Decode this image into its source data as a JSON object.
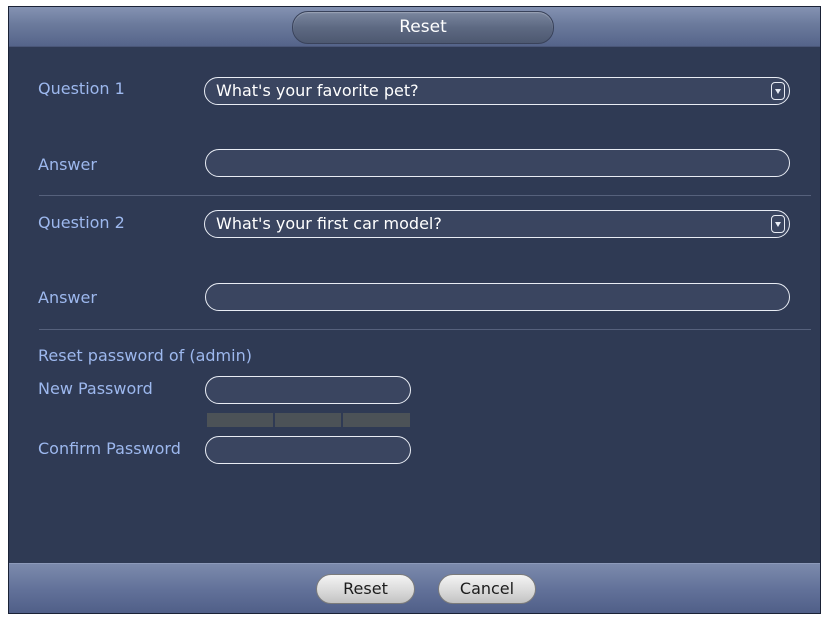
{
  "dialog": {
    "title": "Reset"
  },
  "question1": {
    "label": "Question 1",
    "value": "What's your favorite pet?"
  },
  "answer1": {
    "label": "Answer",
    "value": ""
  },
  "question2": {
    "label": "Question 2",
    "value": "What's your first car model?"
  },
  "answer2": {
    "label": "Answer",
    "value": ""
  },
  "reset_section": {
    "heading": "Reset password of (admin)",
    "new_password_label": "New Password",
    "new_password_value": "",
    "confirm_password_label": "Confirm Password",
    "confirm_password_value": "",
    "strength_segments": 3
  },
  "footer": {
    "reset_label": "Reset",
    "cancel_label": "Cancel"
  },
  "icons": {
    "dropdown": "chevron-down-icon"
  },
  "colors": {
    "panel_bg": "#2f3a54",
    "label_text": "#9db8ee",
    "field_border": "#e8ecf4",
    "strength_bar": "#4c5257"
  }
}
